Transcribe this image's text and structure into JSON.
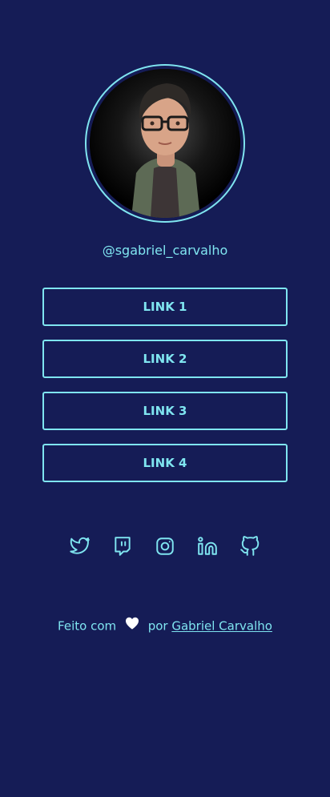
{
  "profile": {
    "username": "@sgabriel_carvalho"
  },
  "links": [
    {
      "label": "LINK 1"
    },
    {
      "label": "LINK 2"
    },
    {
      "label": "LINK 3"
    },
    {
      "label": "LINK 4"
    }
  ],
  "socials": [
    {
      "icon": "twitter-icon"
    },
    {
      "icon": "twitch-icon"
    },
    {
      "icon": "instagram-icon"
    },
    {
      "icon": "linkedin-icon"
    },
    {
      "icon": "github-icon"
    }
  ],
  "footer": {
    "prefix": "Feito com",
    "middle": "por",
    "author": "Gabriel Carvalho"
  },
  "colors": {
    "background": "#151c56",
    "accent": "#7fe5f0",
    "heart": "#ffffff"
  }
}
